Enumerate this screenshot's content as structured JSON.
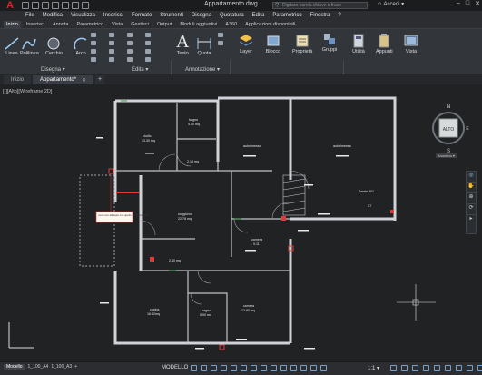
{
  "window": {
    "title": "Appartamento.dwg",
    "search_placeholder": "Digitare parola chiave o frase",
    "signin_label": "Accedi",
    "logo_letter": "A"
  },
  "menu": [
    "File",
    "Modifica",
    "Visualizza",
    "Inserisci",
    "Formato",
    "Strumenti",
    "Disegna",
    "Quotatura",
    "Edita",
    "Parametrico",
    "Finestra",
    "?"
  ],
  "ribbon_tabs": [
    "Inizio",
    "Inserisci",
    "Annota",
    "Parametrico",
    "Vista",
    "Gestisci",
    "Output",
    "Moduli aggiuntivi",
    "A360",
    "Applicazioni disponibili"
  ],
  "ribbon": {
    "draw": [
      "Linea",
      "Polilinea",
      "Cerchio",
      "Arco"
    ],
    "draw_panel": "Disegna",
    "edit_panel": "Edita",
    "annot": [
      "Testo",
      "Quota"
    ],
    "annot_panel": "Annotazione",
    "big": [
      "Layer",
      "Blocco",
      "Proprietà",
      "Gruppi",
      "Utilità",
      "Appunti",
      "Vista"
    ]
  },
  "doc_tabs": {
    "start": "Inizio",
    "active": "Appartamento*"
  },
  "viewport_label": "[-][Alto][Wireframe 2D]",
  "viewcube": {
    "north": "N",
    "south": "S",
    "east": "E",
    "top": "ALTO",
    "wcs": "Anonimo"
  },
  "rooms": [
    {
      "name": "studio",
      "area": "13.30 mq"
    },
    {
      "name": "bagno",
      "area": "4.40 mq"
    },
    {
      "name": "",
      "area": "2.15 mq"
    },
    {
      "name": "autorimessa",
      "area": ""
    },
    {
      "name": "autorimessa",
      "area": ""
    },
    {
      "name": "soggiorno",
      "area": "22.78 mq"
    },
    {
      "name": "camera",
      "area": "9.11"
    },
    {
      "name": "",
      "area": "2.50 mq"
    },
    {
      "name": "cucina",
      "area": "16.82mq"
    },
    {
      "name": "bagno",
      "area": "5.90 mq"
    },
    {
      "name": "camera",
      "area": "13.80 mq"
    }
  ],
  "annotations": {
    "note": "muro non allineato con quello del piano primo",
    "parete": "Parete REI",
    "c7": "C7"
  },
  "layout_tabs": [
    "Modello",
    "1_100_A4",
    "1_100_A3"
  ],
  "status": {
    "mode": "MODELLO",
    "scale": "1:1"
  }
}
